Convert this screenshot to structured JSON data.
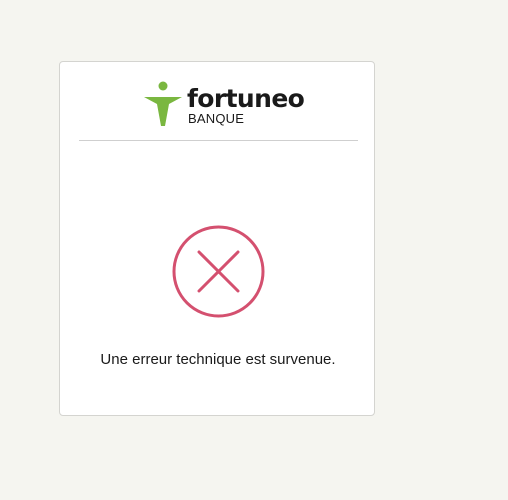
{
  "brand": {
    "name": "fortuneo",
    "sub": "BANQUE",
    "logo_icon": "fortuneo-star-person-icon",
    "accent_color": "#7ab740"
  },
  "error": {
    "icon": "error-circle-x-icon",
    "icon_color": "#d4506f",
    "message": "Une erreur technique est survenue."
  }
}
